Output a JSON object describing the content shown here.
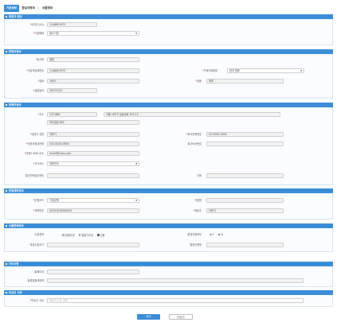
{
  "tabs": [
    {
      "label": "기본정보",
      "active": true
    },
    {
      "label": "참입지정보"
    },
    {
      "label": "상품정보"
    }
  ],
  "tab_separator": "|",
  "sections": {
    "member": {
      "title": "회원자 정보",
      "id_label": "아이디 (ID)",
      "id_value": "1148601975",
      "type_label": "기업형태",
      "type_value": "중소기업"
    },
    "seller": {
      "title": "판매자정보",
      "company_label": "회사명",
      "company_value": "회원",
      "bizno_label": "사업자등록번호",
      "bizno_value": "1148601975",
      "trade_label": "구매거래희망",
      "trade_value": "한국 원화",
      "industry_label": "업태",
      "industry_value": "서비스",
      "item_label": "업종",
      "item_value": "제조",
      "founded_label": "설립일자",
      "founded_value": "20070131"
    },
    "seller2": {
      "title": "판매자정보",
      "address_label": "주소",
      "zip_value": "137-889",
      "addr1_value": "서울 서초구 강남대로 343-15",
      "addr2_value": "미우빌딩 602",
      "ceo_label": "대표자 성명",
      "ceo_value": "이포가",
      "phone_label": "회사전화번호",
      "phone_value": "02-0000-0000",
      "mobile_label": "대표자휴대전화",
      "mobile_value": "010-0020-0000",
      "fax_label": "회사FAX번호",
      "fax_value": "",
      "email_label": "대표E-MAIL주소",
      "email_value": "email@rudo.com",
      "country_label": "국가코드",
      "country_value": "대한민국",
      "mailorder_label": "통신판매업(허용)",
      "mailorder_value": "",
      "cert_label": "인증",
      "cert_value": ""
    },
    "bank": {
      "title": "판매계좌정보",
      "bank_label": "은행코드",
      "bank_value": "기업은행",
      "branch_label": "지점명",
      "branch_value": "",
      "account_label": "계좌번호",
      "account_value": "00101010000022",
      "holder_label": "예금주",
      "holder_value": "이포가"
    },
    "export": {
      "title": "수출판촉정보",
      "exp_label": "수출경력",
      "exp_options": [
        "경험무경",
        "컬럼가무경",
        "있음"
      ],
      "exp_selected": 2,
      "certify_label": "품질인증여부",
      "certify_options": [
        "Y",
        "N"
      ],
      "certify_selected": 1,
      "rep_label": "대표수출국가",
      "rep_value": "",
      "quality_label": "품질인증명",
      "quality_value": ""
    },
    "etc": {
      "title": "기타사항",
      "homepage_label": "홈페이지",
      "homepage_value": "",
      "intro_label": "등록업종내정책",
      "intro_value": ""
    },
    "approval": {
      "title": "미승인 사유",
      "reason_label": "미승인 사유",
      "reason_placeholder": "미승인 사유 입력"
    }
  },
  "buttons": {
    "approve": "승인",
    "reject": "미승인"
  },
  "colors": {
    "accent": "#3b8ed6",
    "required": "#e04040"
  }
}
